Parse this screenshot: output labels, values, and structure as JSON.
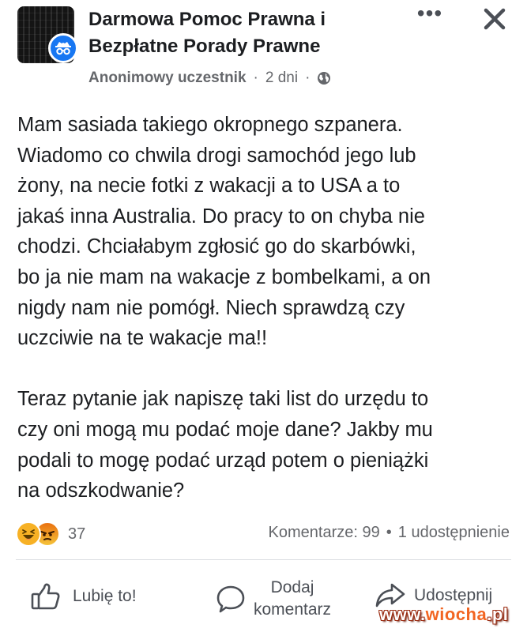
{
  "header": {
    "group_name": "Darmowa Pomoc Prawna i Bezpłatne Porady Prawne",
    "author": "Anonimowy uczestnik",
    "time": "2 dni",
    "separator": "·",
    "privacy_icon": "globe-icon",
    "more_icon": "more-horizontal-icon",
    "more_label": "•••",
    "close_icon": "close-icon"
  },
  "post": {
    "paragraph1": [
      "Mam sasiada takiego okropnego szpanera.",
      "Wiadomo co chwila drogi samochód jego lub",
      "żony, na necie fotki z wakacji a to USA a to",
      "jakaś inna Australia. Do pracy to on chyba nie",
      "chodzi. Chciałabym zgłosić go do skarbówki,",
      "bo ja nie mam na wakacje z bombelkami, a on",
      "nigdy nam nie pomógł. Niech sprawdzą czy",
      "uczciwie na te wakacje ma!!"
    ],
    "paragraph2": [
      "Teraz pytanie jak napiszę taki list do urzędu to",
      "czy oni mogą mu podać moje dane? Jakby mu",
      "podali to mogę podać urząd potem o pieniążki",
      "na odszkodwanie?"
    ]
  },
  "engagement": {
    "reaction_icons": [
      "haha-reaction-icon",
      "angry-reaction-icon"
    ],
    "reaction_count": "37",
    "comments": "Komentarze: 99",
    "dot": "•",
    "shares": "1 udostępnienie"
  },
  "actions": {
    "like_label": "Lubię to!",
    "comment_label": "Dodaj\nkomentarz",
    "share_label": "Udostępnij"
  },
  "watermark": {
    "prefix": "www.",
    "brand": "wiocha",
    "suffix": ".pl"
  },
  "colors": {
    "accent": "#1877f2",
    "text": "#1c1e21",
    "muted": "#65676b",
    "haha": "#f7b125",
    "angry": "#e9710f"
  }
}
